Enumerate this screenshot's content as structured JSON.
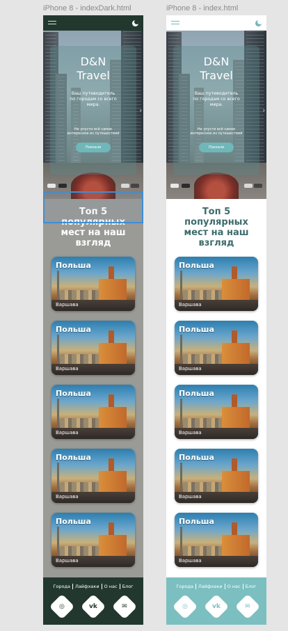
{
  "artboards": [
    {
      "title": "iPhone 8 - indexDark.html"
    },
    {
      "title": "iPhone 8 - index.html"
    }
  ],
  "hero": {
    "title": "D&N\nTravel",
    "subtitle": "Ваш путеводитель\nпо городам со всего\nмира.",
    "small": "Не упусти всё самое\nинтересное из путешествий",
    "button": "Поехали",
    "arrow": "›"
  },
  "section": {
    "title": "Топ 5\nпопулярных\nмест на наш\nвзгляд"
  },
  "cards": [
    {
      "country": "Польша",
      "city": "Варшава"
    },
    {
      "country": "Польша",
      "city": "Варшава"
    },
    {
      "country": "Польша",
      "city": "Варшава"
    },
    {
      "country": "Польша",
      "city": "Варшава"
    },
    {
      "country": "Польша",
      "city": "Варшава"
    }
  ],
  "footer": {
    "links": [
      "Города",
      "Лайфхаки",
      "О нас",
      "Блог"
    ],
    "socials": [
      {
        "icon": "instagram-icon",
        "glyph": "◎"
      },
      {
        "icon": "vk-icon",
        "glyph": "vk"
      },
      {
        "icon": "mail-icon",
        "glyph": "✉"
      }
    ]
  },
  "colors": {
    "dark_bar": "#22382f",
    "dark_body": "#9a9a96",
    "teal_accent": "#6fb7b9",
    "light_footer": "#7cbfc1",
    "selection": "#3d8ed8"
  }
}
